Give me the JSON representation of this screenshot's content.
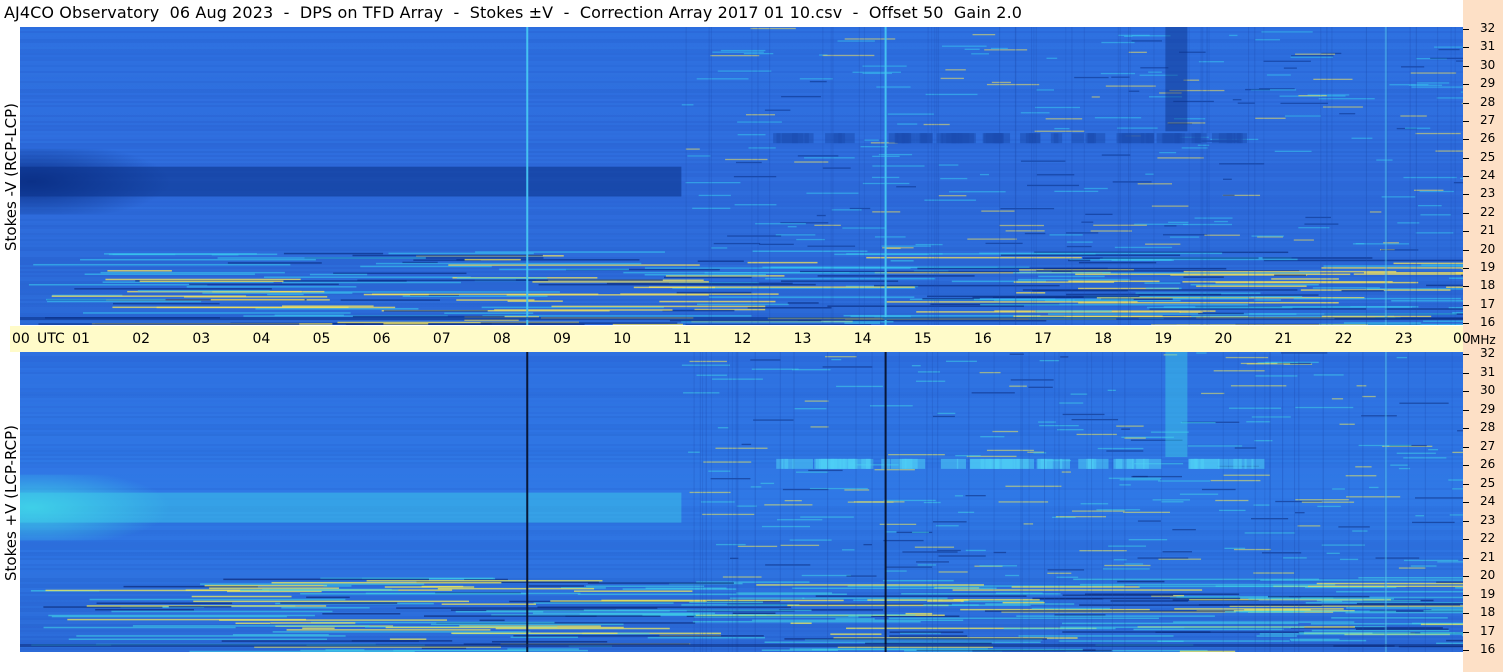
{
  "title": "AJ4CO Observatory  06 Aug 2023  -  DPS on TFD Array  -  Stokes ±V  -  Correction Array 2017 01 10.csv  -  Offset 50  Gain 2.0",
  "chart_data": [
    {
      "type": "heatmap",
      "panel": "top",
      "ylabel": "Stokes -V (RCP-LCP)",
      "x_ticks": [
        "00",
        "UTC",
        "01",
        "02",
        "03",
        "04",
        "05",
        "06",
        "07",
        "08",
        "09",
        "10",
        "11",
        "12",
        "13",
        "14",
        "15",
        "16",
        "17",
        "18",
        "19",
        "20",
        "21",
        "22",
        "23",
        "00",
        "MHz"
      ],
      "y_ticks": [
        "32",
        "31",
        "30",
        "29",
        "28",
        "27",
        "26",
        "25",
        "24",
        "23",
        "22",
        "21",
        "20",
        "19",
        "18",
        "17",
        "16"
      ],
      "ylim": [
        16,
        32
      ],
      "xlim": [
        0,
        24
      ],
      "colors": {
        "base": "#2e6bdc",
        "dark": "#0a2f86",
        "bright": "#39c8f0",
        "hot": "#f5e35a"
      }
    },
    {
      "type": "heatmap",
      "panel": "bottom",
      "ylabel": "Stokes +V (LCP-RCP)",
      "y_ticks": [
        "32",
        "31",
        "30",
        "29",
        "28",
        "27",
        "26",
        "25",
        "24",
        "23",
        "22",
        "21",
        "20",
        "19",
        "18",
        "17",
        "16"
      ],
      "ylim": [
        16,
        32
      ],
      "xlim": [
        0,
        24
      ],
      "colors": {
        "base": "#2f78e6",
        "dark": "#0b2a7a",
        "bright": "#3fd2e8",
        "hot": "#f0ea5a"
      }
    }
  ],
  "axis": {
    "hours": [
      "00",
      "01",
      "02",
      "03",
      "04",
      "05",
      "06",
      "07",
      "08",
      "09",
      "10",
      "11",
      "12",
      "13",
      "14",
      "15",
      "16",
      "17",
      "18",
      "19",
      "20",
      "21",
      "22",
      "23",
      "00"
    ],
    "utc_label": "UTC",
    "mhz_label": "MHz",
    "freqs": [
      "32",
      "31",
      "30",
      "29",
      "28",
      "27",
      "26",
      "25",
      "24",
      "23",
      "22",
      "21",
      "20",
      "19",
      "18",
      "17",
      "16"
    ]
  }
}
